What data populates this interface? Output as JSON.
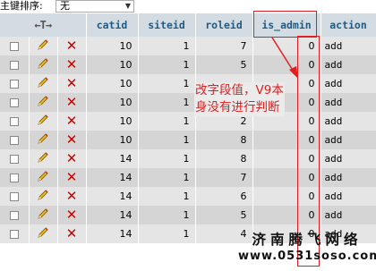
{
  "sort": {
    "label": "主键排序:",
    "value": "无"
  },
  "header": {
    "nav_arrows": "←T→",
    "columns": [
      "catid",
      "siteid",
      "roleid",
      "is_admin",
      "action"
    ]
  },
  "rows": [
    {
      "catid": "10",
      "siteid": "1",
      "roleid": "7",
      "is_admin": "0",
      "action": "add"
    },
    {
      "catid": "10",
      "siteid": "1",
      "roleid": "5",
      "is_admin": "0",
      "action": "add"
    },
    {
      "catid": "10",
      "siteid": "1",
      "roleid": "",
      "is_admin": "0",
      "action": "add"
    },
    {
      "catid": "10",
      "siteid": "1",
      "roleid": "",
      "is_admin": "0",
      "action": "add"
    },
    {
      "catid": "10",
      "siteid": "1",
      "roleid": "2",
      "is_admin": "0",
      "action": "add"
    },
    {
      "catid": "10",
      "siteid": "1",
      "roleid": "8",
      "is_admin": "0",
      "action": "add"
    },
    {
      "catid": "14",
      "siteid": "1",
      "roleid": "8",
      "is_admin": "0",
      "action": "add"
    },
    {
      "catid": "14",
      "siteid": "1",
      "roleid": "7",
      "is_admin": "0",
      "action": "add"
    },
    {
      "catid": "14",
      "siteid": "1",
      "roleid": "6",
      "is_admin": "0",
      "action": "add"
    },
    {
      "catid": "14",
      "siteid": "1",
      "roleid": "5",
      "is_admin": "0",
      "action": "add"
    },
    {
      "catid": "14",
      "siteid": "1",
      "roleid": "4",
      "is_admin": "0",
      "action": "add"
    }
  ],
  "annotation": {
    "line1": "改字段值，V9本",
    "line2": "身没有进行判断"
  },
  "watermark": {
    "line1": "济南腾飞网络",
    "line2": "www.0531soso.com"
  },
  "colors": {
    "header_bg": "#d3dce3",
    "row_odd": "#e5e5e5",
    "row_even": "#d5d5d5",
    "highlight": "#e02020"
  }
}
